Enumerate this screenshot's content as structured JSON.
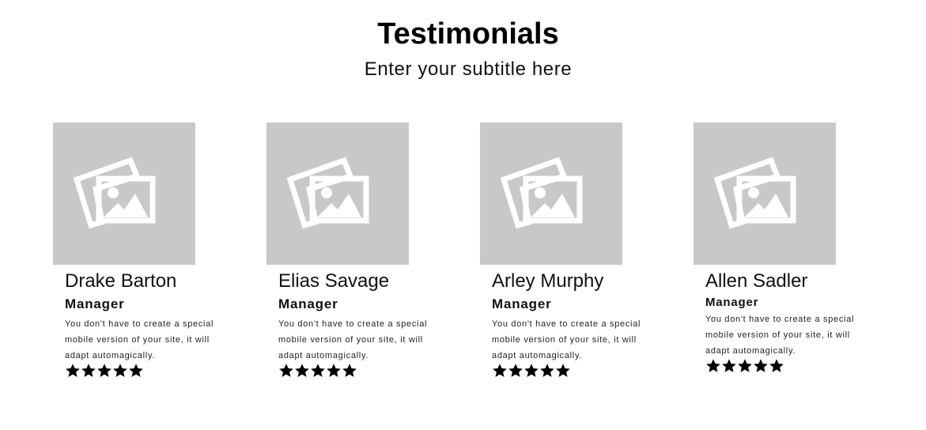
{
  "header": {
    "title": "Testimonials",
    "subtitle": "Enter your subtitle here"
  },
  "icons": {
    "photo_placeholder": "image-placeholder-icon",
    "rating": "star-icon"
  },
  "colors": {
    "placeholder_bg": "#c8c8c8",
    "placeholder_icon": "#ffffff",
    "star": "#000000"
  },
  "testimonials": [
    {
      "name": "Drake Barton",
      "role": "Manager",
      "quote": "You don't have to create a special mobile version of your site, it will adapt automagically.",
      "rating": 5
    },
    {
      "name": "Elias Savage",
      "role": "Manager",
      "quote": "You don't have to create a special mobile version of your site, it will adapt automagically.",
      "rating": 5
    },
    {
      "name": "Arley Murphy",
      "role": "Manager",
      "quote": "You don't have to create a special mobile version of your site, it will adapt automagically.",
      "rating": 5
    },
    {
      "name": "Allen Sadler",
      "role": "Manager",
      "quote": "You don't have to create a special mobile version of your site, it will adapt automagically.",
      "rating": 5
    }
  ]
}
